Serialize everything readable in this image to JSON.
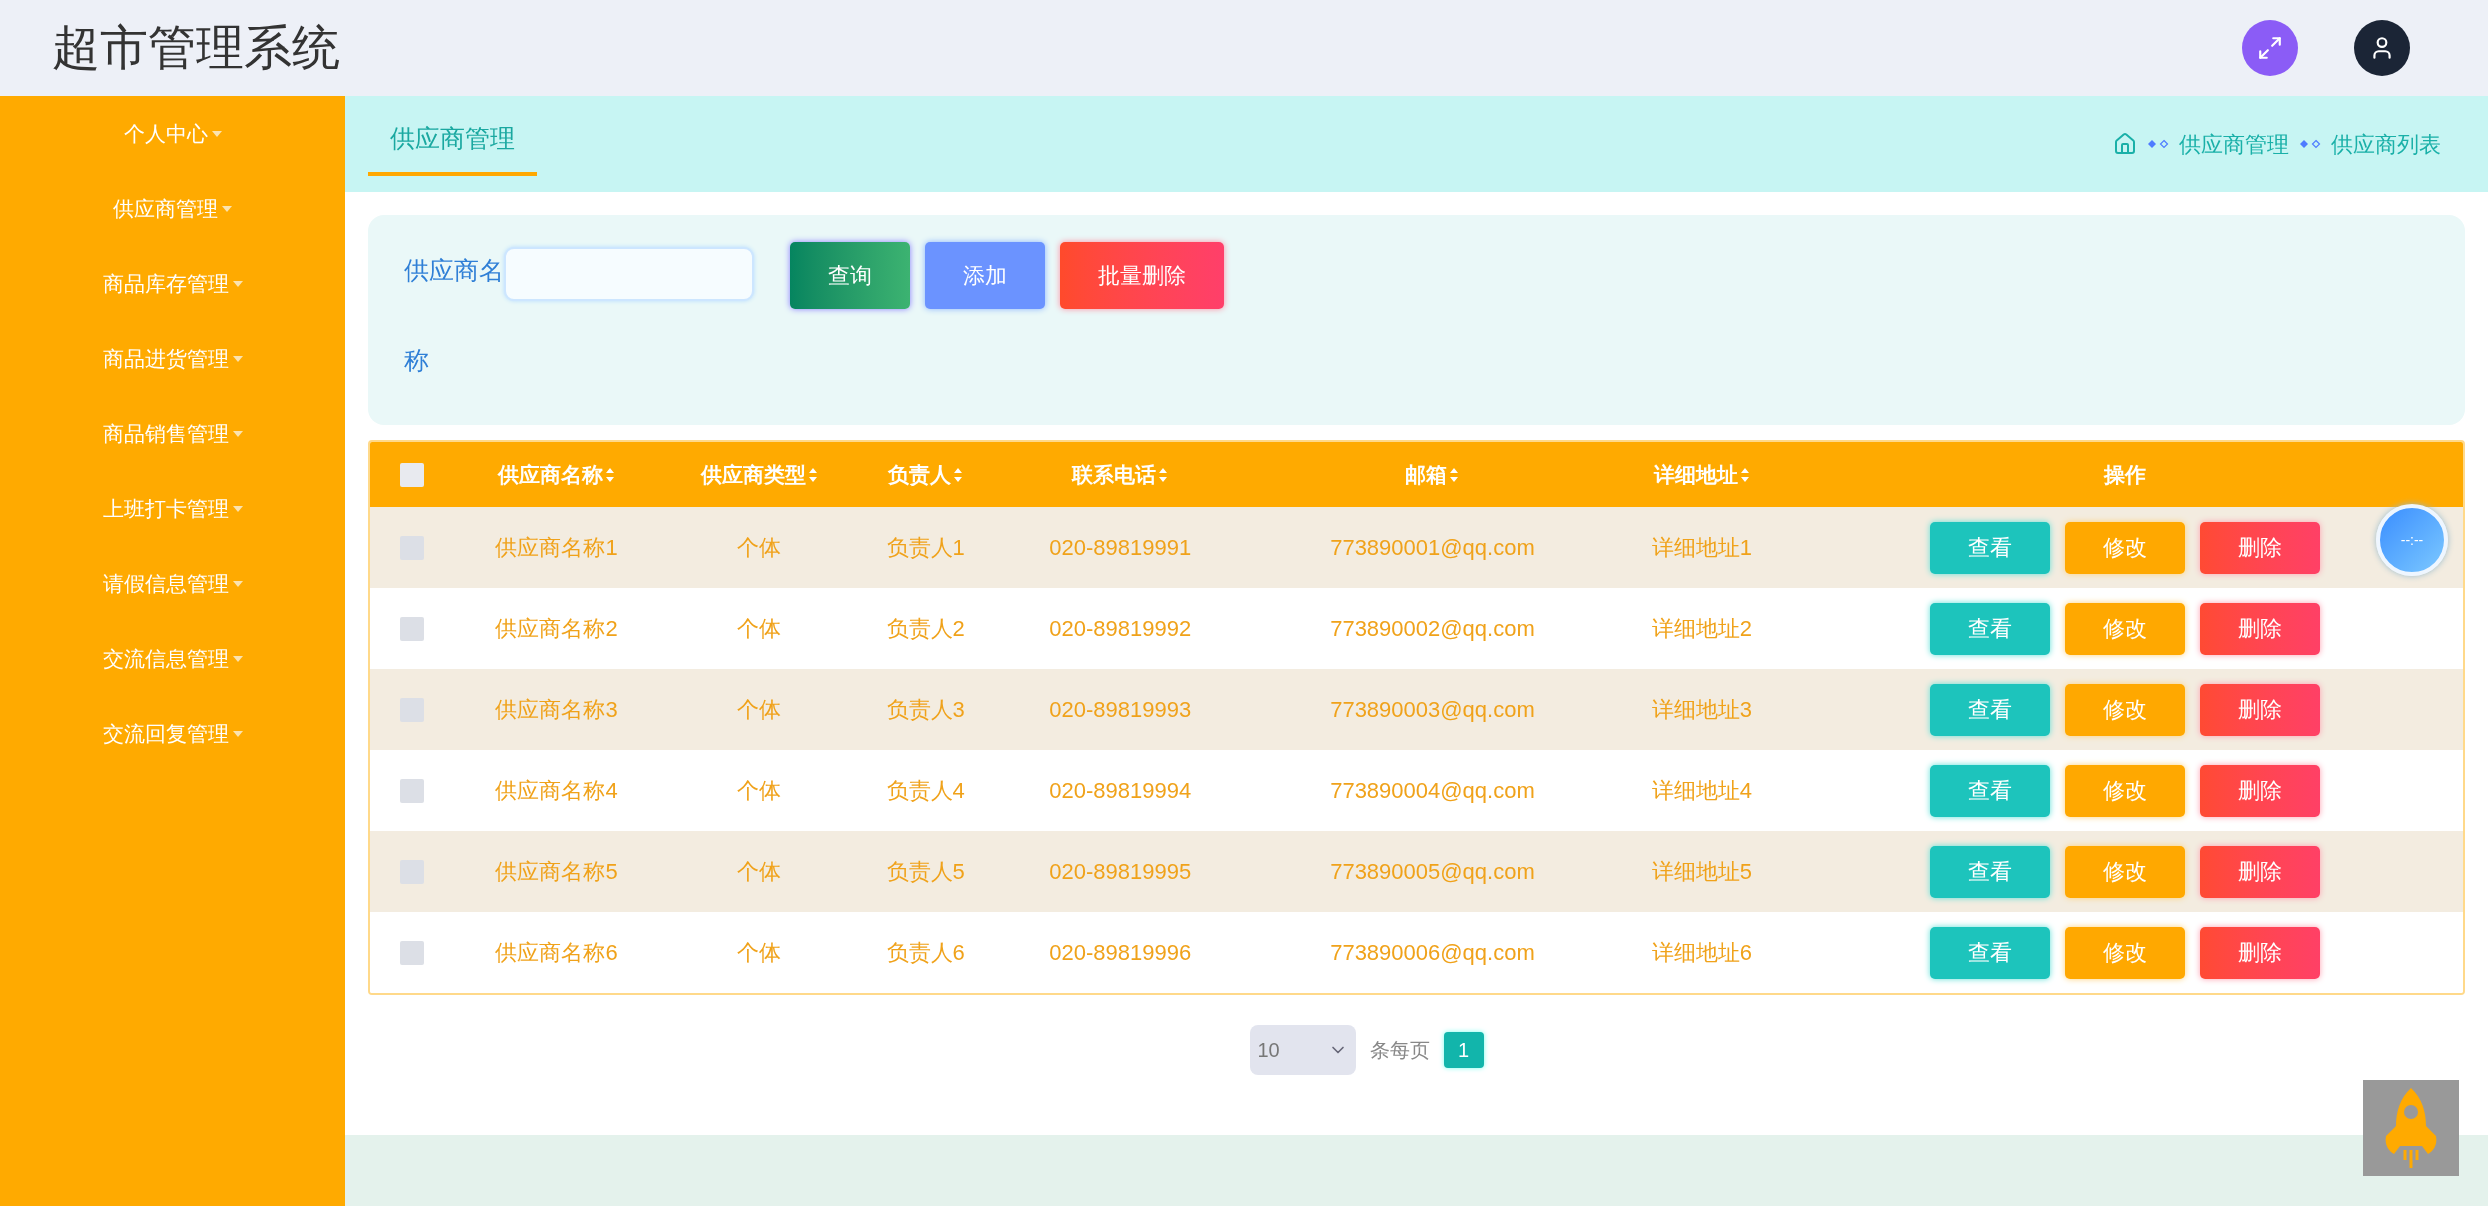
{
  "header": {
    "title": "超市管理系统"
  },
  "sidebar": {
    "items": [
      {
        "label": "个人中心"
      },
      {
        "label": "供应商管理"
      },
      {
        "label": "商品库存管理"
      },
      {
        "label": "商品进货管理"
      },
      {
        "label": "商品销售管理"
      },
      {
        "label": "上班打卡管理"
      },
      {
        "label": "请假信息管理"
      },
      {
        "label": "交流信息管理"
      },
      {
        "label": "交流回复管理"
      }
    ]
  },
  "page_tab": {
    "label": "供应商管理",
    "selected": true
  },
  "breadcrumb": [
    "供应商管理",
    "供应商列表"
  ],
  "search": {
    "label": "供应商名称",
    "buttons": [
      {
        "label": "查询",
        "kind": "query"
      },
      {
        "label": "添加",
        "kind": "add"
      },
      {
        "label": "批量删除",
        "kind": "delete"
      }
    ]
  },
  "table": {
    "select_all": {
      "checked": false
    },
    "columns": [
      {
        "label": "供应商名称",
        "sortable": true
      },
      {
        "label": "供应商类型",
        "sortable": true
      },
      {
        "label": "负责人",
        "sortable": true
      },
      {
        "label": "联系电话",
        "sortable": true
      },
      {
        "label": "邮箱",
        "sortable": true
      },
      {
        "label": "详细地址",
        "sortable": true
      },
      {
        "label": "操作",
        "sortable": false
      }
    ],
    "rows": [
      {
        "checked": false,
        "cells": [
          "供应商名称1",
          "个体",
          "负责人1",
          "020-89819991",
          "773890001@qq.com",
          "详细地址1"
        ],
        "actions": [
          {
            "label": "查看",
            "kind": "view"
          },
          {
            "label": "修改",
            "kind": "edit"
          },
          {
            "label": "删除",
            "kind": "delete"
          }
        ]
      },
      {
        "checked": false,
        "cells": [
          "供应商名称2",
          "个体",
          "负责人2",
          "020-89819992",
          "773890002@qq.com",
          "详细地址2"
        ],
        "actions": [
          {
            "label": "查看",
            "kind": "view"
          },
          {
            "label": "修改",
            "kind": "edit"
          },
          {
            "label": "删除",
            "kind": "delete"
          }
        ]
      },
      {
        "checked": false,
        "cells": [
          "供应商名称3",
          "个体",
          "负责人3",
          "020-89819993",
          "773890003@qq.com",
          "详细地址3"
        ],
        "actions": [
          {
            "label": "查看",
            "kind": "view"
          },
          {
            "label": "修改",
            "kind": "edit"
          },
          {
            "label": "删除",
            "kind": "delete"
          }
        ]
      },
      {
        "checked": false,
        "cells": [
          "供应商名称4",
          "个体",
          "负责人4",
          "020-89819994",
          "773890004@qq.com",
          "详细地址4"
        ],
        "actions": [
          {
            "label": "查看",
            "kind": "view"
          },
          {
            "label": "修改",
            "kind": "edit"
          },
          {
            "label": "删除",
            "kind": "delete"
          }
        ]
      },
      {
        "checked": false,
        "cells": [
          "供应商名称5",
          "个体",
          "负责人5",
          "020-89819995",
          "773890005@qq.com",
          "详细地址5"
        ],
        "actions": [
          {
            "label": "查看",
            "kind": "view"
          },
          {
            "label": "修改",
            "kind": "edit"
          },
          {
            "label": "删除",
            "kind": "delete"
          }
        ]
      },
      {
        "checked": false,
        "cells": [
          "供应商名称6",
          "个体",
          "负责人6",
          "020-89819996",
          "773890006@qq.com",
          "详细地址6"
        ],
        "actions": [
          {
            "label": "查看",
            "kind": "view"
          },
          {
            "label": "修改",
            "kind": "edit"
          },
          {
            "label": "删除",
            "kind": "delete"
          }
        ]
      }
    ]
  },
  "pagination": {
    "page_size": "10",
    "per_page_label": "条每页",
    "pages": [
      {
        "label": "1",
        "selected": true
      }
    ]
  },
  "clock": {
    "text": "--:--"
  }
}
